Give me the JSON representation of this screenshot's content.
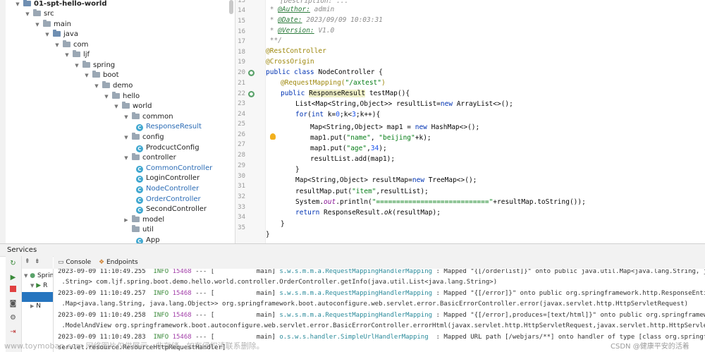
{
  "project_tree": {
    "items": [
      {
        "label": "01-spt-hello-world",
        "type": "module",
        "expanded": true
      },
      {
        "label": "src",
        "type": "folder",
        "expanded": true
      },
      {
        "label": "main",
        "type": "folder",
        "expanded": true
      },
      {
        "label": "java",
        "type": "folder",
        "expanded": true
      },
      {
        "label": "com",
        "type": "package",
        "expanded": true
      },
      {
        "label": "ljf",
        "type": "package",
        "expanded": true
      },
      {
        "label": "spring",
        "type": "package",
        "expanded": true
      },
      {
        "label": "boot",
        "type": "package",
        "expanded": true
      },
      {
        "label": "demo",
        "type": "package",
        "expanded": true
      },
      {
        "label": "hello",
        "type": "package",
        "expanded": true
      },
      {
        "label": "world",
        "type": "package",
        "expanded": true
      },
      {
        "label": "common",
        "type": "package",
        "expanded": true
      },
      {
        "label": "ResponseResult",
        "type": "class"
      },
      {
        "label": "config",
        "type": "package",
        "expanded": true
      },
      {
        "label": "ProdcuctConfig",
        "type": "class"
      },
      {
        "label": "controller",
        "type": "package",
        "expanded": true
      },
      {
        "label": "CommonController",
        "type": "class"
      },
      {
        "label": "LoginController",
        "type": "class"
      },
      {
        "label": "NodeController",
        "type": "class"
      },
      {
        "label": "OrderController",
        "type": "class"
      },
      {
        "label": "SecondController",
        "type": "class"
      },
      {
        "label": "model",
        "type": "package",
        "expanded": false
      },
      {
        "label": "util",
        "type": "package",
        "expanded": false
      },
      {
        "label": "App",
        "type": "class"
      }
    ]
  },
  "editor": {
    "line_numbers": [
      "13",
      "14",
      "15",
      "16",
      "17",
      "18",
      "19",
      "20",
      "21",
      "22",
      "23",
      "24",
      "25",
      "26",
      "27",
      "28",
      "29",
      "30",
      "31",
      "32",
      "33",
      "34",
      "35"
    ],
    "lines": {
      "l13": "[Description: ...",
      "l14_pre": " * ",
      "l14_tag": "@Author:",
      "l14_val": " admin",
      "l15_pre": " * ",
      "l15_tag": "@Date:",
      "l15_val": " 2023/09/09 10:03:31",
      "l16_pre": " * ",
      "l16_tag": "@Version:",
      "l16_val": " V1.0",
      "l17": " **/",
      "l18": "@RestController",
      "l19": "@CrossOrigin",
      "l20_kw": "public class",
      "l20_rest": " NodeController {",
      "l21_ann": "@RequestMapping(",
      "l21_str": "\"/axtest\"",
      "l21_end": ")",
      "l22_kw": "public",
      "l22_type": "ResponseResult",
      "l22_rest": " testMap(){",
      "l23_a": "List<Map<String,Object>> resultList=",
      "l23_kw": "new",
      "l23_b": " ArrayList<>();",
      "l24_kw": "for",
      "l24_a": "(",
      "l24_kw2": "int",
      "l24_b": " k=",
      "l24_n1": "0",
      "l24_c": ";k<",
      "l24_n2": "3",
      "l24_d": ";k++){",
      "l25_a": "Map<String,Object> map1 = ",
      "l25_kw": "new",
      "l25_b": " HashMap<>();",
      "l26_a": "map1.put(",
      "l26_s1": "\"name\"",
      "l26_b": ", ",
      "l26_s2": "\"beijing\"",
      "l26_c": "+k);",
      "l27_a": "map1.put(",
      "l27_s1": "\"age\"",
      "l27_b": ",",
      "l27_n": "34",
      "l27_c": ");",
      "l28": "resultList.add(map1);",
      "l29": "}",
      "l30_a": "Map<String,Object> resultMap=",
      "l30_kw": "new",
      "l30_b": " TreeMap<>();",
      "l31_a": "resultMap.put(",
      "l31_s": "\"item\"",
      "l31_b": ",resultList);",
      "l32_a": "System.",
      "l32_f": "out",
      "l32_b": ".println(",
      "l32_s": "\"============================\"",
      "l32_c": "+resultMap.toString());",
      "l33_kw": "return",
      "l33_a": " ResponseResult.",
      "l33_m": "ok",
      "l33_b": "(resultMap);",
      "l34": "}",
      "l35": "}"
    }
  },
  "services": {
    "title": "Services",
    "tree_item": "Sprin",
    "tree_subitem": "R",
    "tree_subitem2": "N",
    "tabs": [
      "Console",
      "Endpoints"
    ]
  },
  "console": {
    "lines": [
      {
        "ts": "2023-09-09 11:10:49.255",
        "level": "INFO",
        "pid": "15468",
        "sep": " --- [",
        "thread": "           main]",
        "logger": "s.w.s.m.m.a.RequestMappingHandlerMapping",
        "msg": " : Mapped \"{[/orderlist]}\" onto public java.util.Map<java.lang.String, java.l"
      },
      {
        "cont": " .String> com.ljf.spring.boot.demo.hello.world.controller.OrderController.getInfo(java.util.List<java.lang.String>)"
      },
      {
        "ts": "2023-09-09 11:10:49.257",
        "level": "INFO",
        "pid": "15468",
        "sep": " --- [",
        "thread": "           main]",
        "logger": "s.w.s.m.m.a.RequestMappingHandlerMapping",
        "msg": " : Mapped \"{[/error]}\" onto public org.springframework.http.ResponseEntity<ja"
      },
      {
        "cont": " .Map<java.lang.String, java.lang.Object>> org.springframework.boot.autoconfigure.web.servlet.error.BasicErrorController.error(javax.servlet.http.HttpServletRequest)"
      },
      {
        "ts": "2023-09-09 11:10:49.258",
        "level": "INFO",
        "pid": "15468",
        "sep": " --- [",
        "thread": "           main]",
        "logger": "s.w.s.m.m.a.RequestMappingHandlerMapping",
        "msg": " : Mapped \"{[/error],produces=[text/html]}\" onto public org.springframework.we"
      },
      {
        "cont": " .ModelAndView org.springframework.boot.autoconfigure.web.servlet.error.BasicErrorController.errorHtml(javax.servlet.http.HttpServletRequest,javax.servlet.http.HttpServletResp"
      },
      {
        "ts": "2023-09-09 11:10:49.283",
        "level": "INFO",
        "pid": "15468",
        "sep": " --- [",
        "thread": "           main]",
        "logger": "o.s.w.s.handler.SimpleUrlHandlerMapping",
        "msg": "  : Mapped URL path [/webjars/**] onto handler of type [class org.springframe"
      },
      {
        "cont": "servlet.resource.ResourceHttpRequestHandler]"
      }
    ]
  },
  "watermarks": {
    "left": "www.toymoban.com 网络图片仅供展示，非存储，如有侵权请联系删除。",
    "right": "CSDN @健康平安的活着"
  },
  "colors": {
    "keyword": "#0033b3",
    "string": "#067d17",
    "annotation": "#9e880d",
    "comment": "#8c8c8c",
    "info": "#3a8a3a",
    "pid": "#a23ea8",
    "logger": "#2a8a9a"
  }
}
